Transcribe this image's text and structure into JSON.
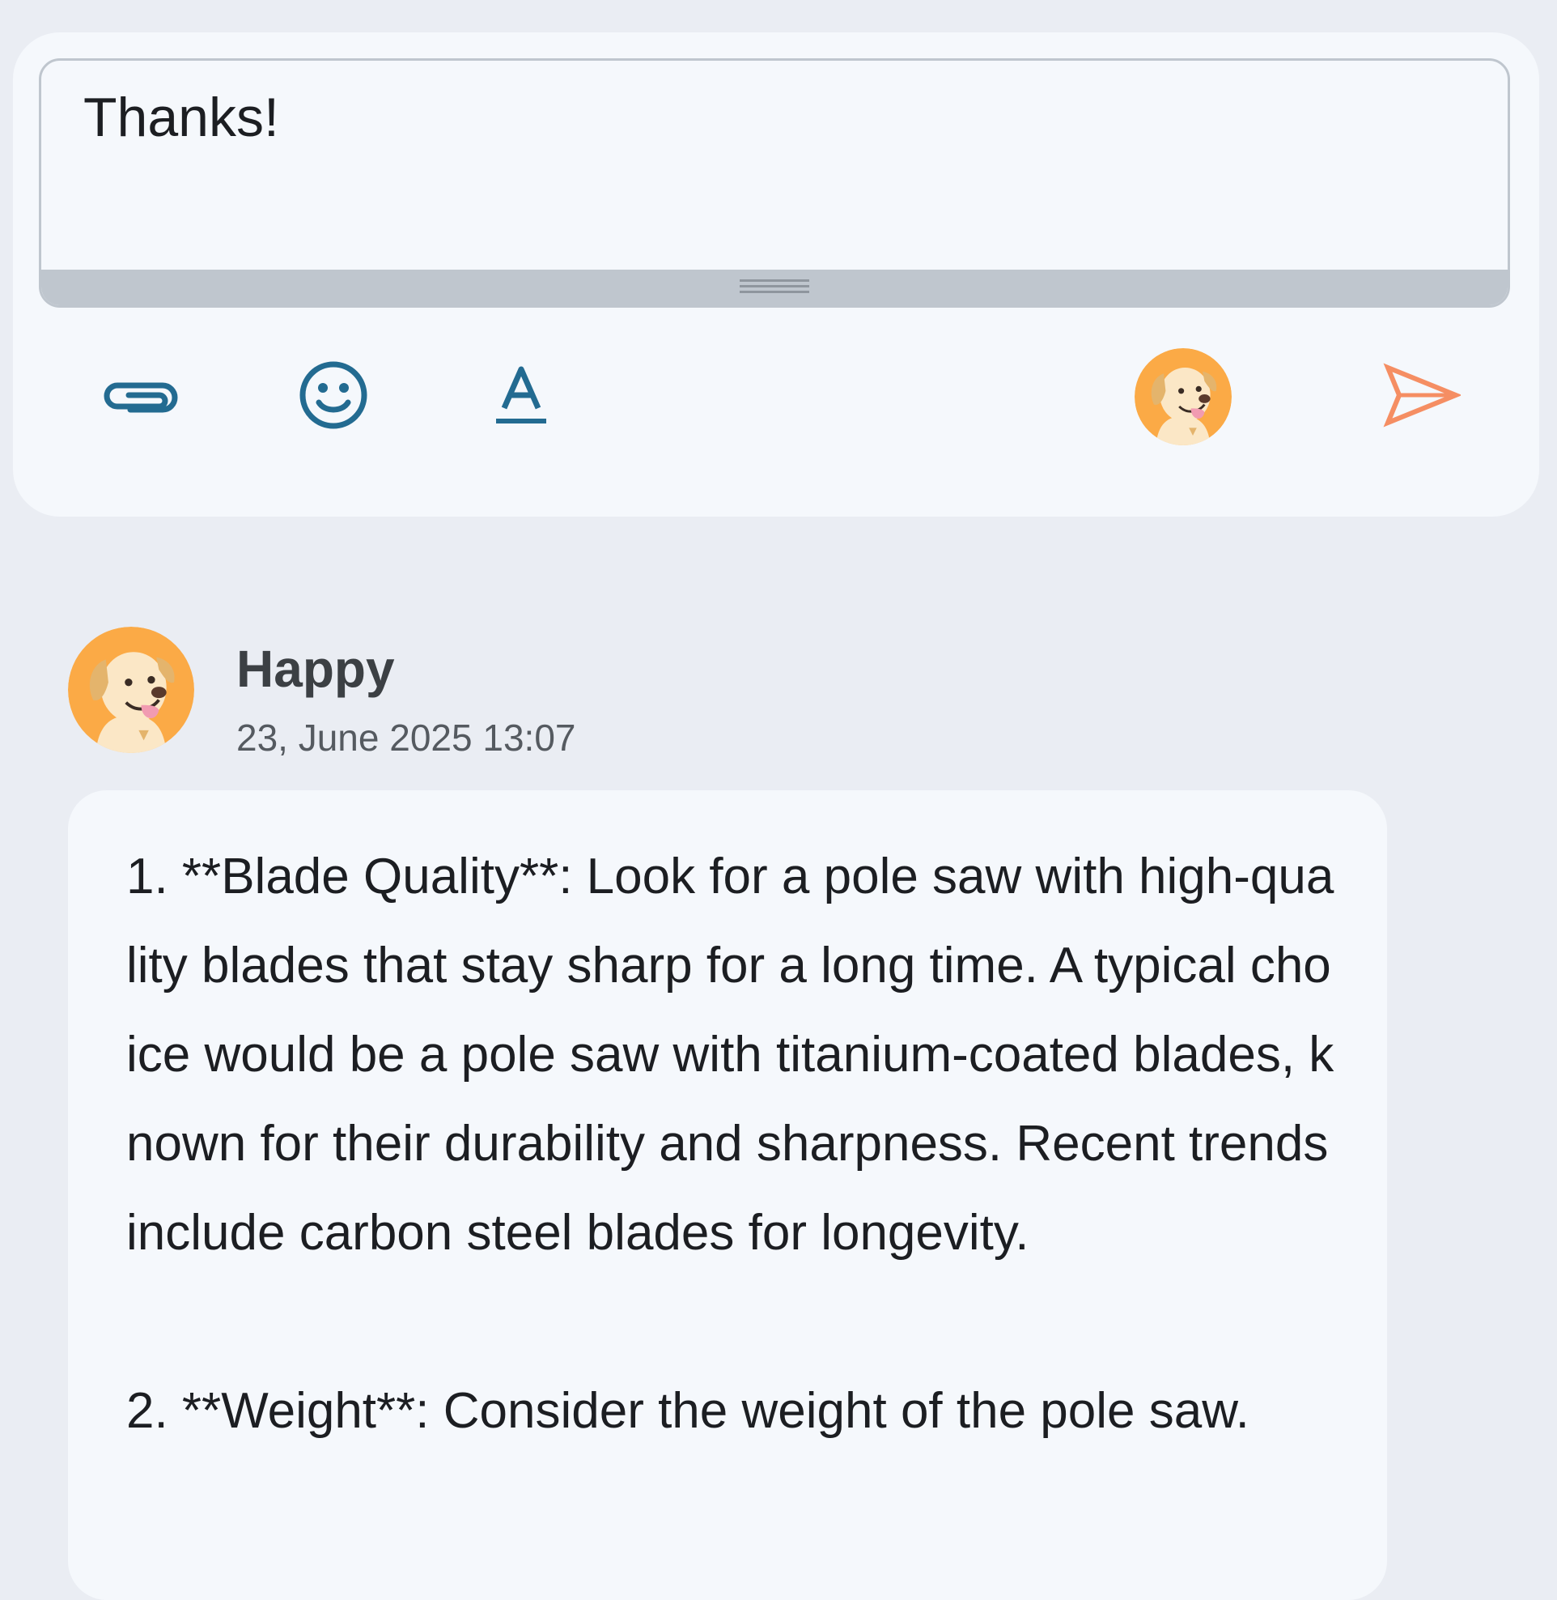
{
  "composer": {
    "input_value": "Thanks!",
    "attach_icon": "paperclip-icon",
    "emoji_icon": "smiley-icon",
    "format_icon": "text-format-icon",
    "avatar_icon": "dog-avatar-icon",
    "send_icon": "send-icon",
    "colors": {
      "tool": "#236b91",
      "send": "#f58e63",
      "avatar_bg": "#fbaa46"
    }
  },
  "message": {
    "author": "Happy",
    "timestamp": "23, June 2025 13:07",
    "paragraphs": [
      "1. **Blade Quality**: Look for a pole saw with high-quality blades that stay sharp for a long time. A typical choice would be a pole saw with titanium-coated blades, known for their durability and sharpness. Recent trends include carbon steel blades for longevity.",
      "2. **Weight**: Consider the weight of the pole saw."
    ]
  }
}
